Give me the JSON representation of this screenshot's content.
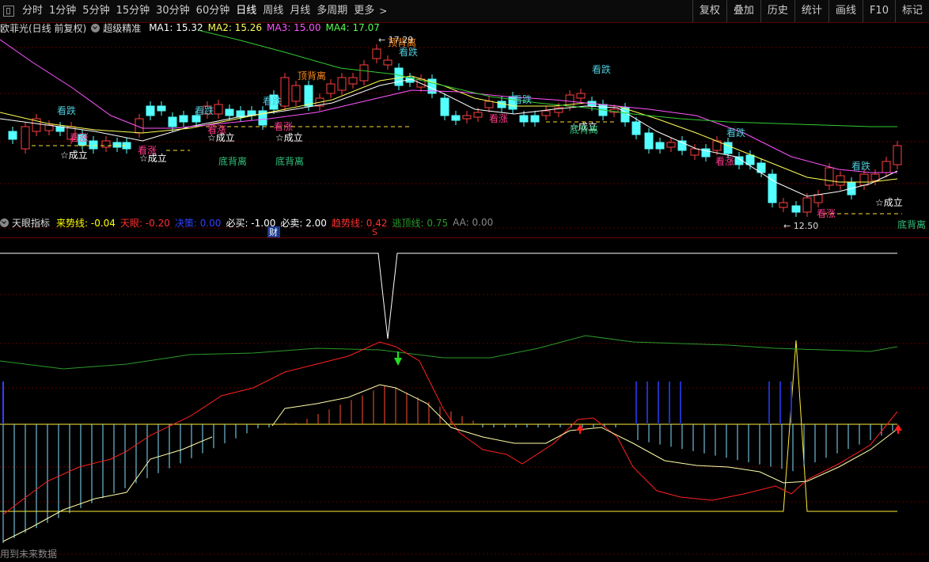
{
  "toolbar": {
    "periods": [
      "分时",
      "1分钟",
      "5分钟",
      "15分钟",
      "30分钟",
      "60分钟",
      "日线",
      "周线",
      "月线",
      "多周期",
      "更多"
    ],
    "active_period": "日线",
    "right_buttons": [
      "复权",
      "叠加",
      "历史",
      "统计",
      "画线",
      "F10",
      "标记"
    ]
  },
  "upper": {
    "stock_name": "欧菲光(日线 前复权)",
    "indicator_name": "超级精准",
    "ma": [
      {
        "label": "MA1: 15.32",
        "color": "#ffffff"
      },
      {
        "label": "MA2: 15.26",
        "color": "#ffff55"
      },
      {
        "label": "MA3: 15.00",
        "color": "#ff55ff"
      },
      {
        "label": "MA4: 17.07",
        "color": "#55ff55"
      }
    ],
    "high_marker": "17.29",
    "low_marker": "12.50",
    "badge_cai": "财",
    "badge_s": "S"
  },
  "annotations": {
    "kandie": "看跌",
    "kanzhang": "看涨",
    "chengli": "☆成立",
    "dibeili": "底背离",
    "dingbeili": "顶背离"
  },
  "lower": {
    "indicator_name": "天眼指标",
    "items": [
      {
        "label": "来势线: -0.04",
        "color": "#ffff00"
      },
      {
        "label": "天眼: -0.20",
        "color": "#ff3030"
      },
      {
        "label": "决策: 0.00",
        "color": "#3040ff"
      },
      {
        "label": "必买: -1.00",
        "color": "#ffffff"
      },
      {
        "label": "必卖: 2.00",
        "color": "#ffffff"
      },
      {
        "label": "趋势线: 0.42",
        "color": "#ff3030"
      },
      {
        "label": "逃顶线: 0.75",
        "color": "#2a9a2a"
      },
      {
        "label": "AA: 0.00",
        "color": "#888888"
      }
    ],
    "footer_note": "用到未来数据"
  },
  "colors": {
    "up": "#ff4040",
    "down": "#54ffff",
    "ma1": "#ffffff",
    "ma2": "#ffff55",
    "ma3": "#ff55ff",
    "ma4": "#33cc33"
  }
}
